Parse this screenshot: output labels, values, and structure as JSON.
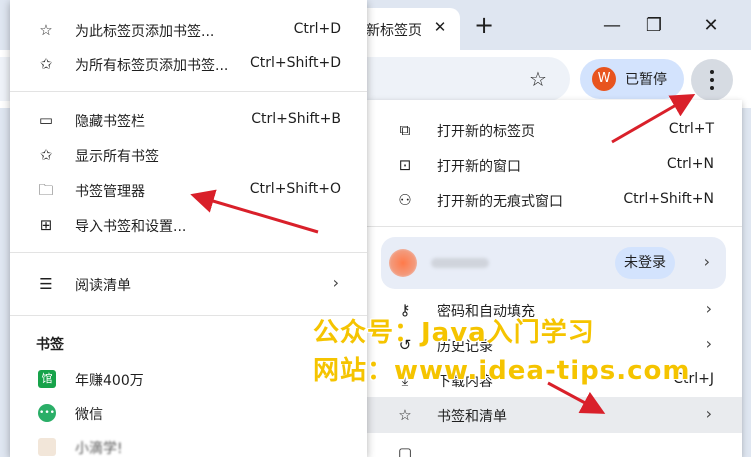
{
  "browser": {
    "tab_title": "新标签页",
    "profile_chip": {
      "initial": "W",
      "label": "已暂停"
    }
  },
  "main_menu": {
    "items_top": [
      {
        "icon": "new-tab-icon",
        "label": "打开新的标签页",
        "shortcut": "Ctrl+T"
      },
      {
        "icon": "new-window-icon",
        "label": "打开新的窗口",
        "shortcut": "Ctrl+N"
      },
      {
        "icon": "incognito-icon",
        "label": "打开新的无痕式窗口",
        "shortcut": "Ctrl+Shift+N"
      }
    ],
    "profile": {
      "login_label": "未登录"
    },
    "items_bottom": [
      {
        "icon": "key-icon",
        "label": "密码和自动填充"
      },
      {
        "icon": "history-icon",
        "label": "历史记录"
      },
      {
        "icon": "download-icon",
        "label": "下载内容",
        "shortcut": "Ctrl+J"
      },
      {
        "icon": "star-icon",
        "label": "书签和清单"
      }
    ]
  },
  "bookmarks_menu": {
    "items_top": [
      {
        "icon": "star-outline-icon",
        "label": "为此标签页添加书签...",
        "shortcut": "Ctrl+D"
      },
      {
        "icon": "star-multi-icon",
        "label": "为所有标签页添加书签...",
        "shortcut": "Ctrl+Shift+D"
      }
    ],
    "items_mid": [
      {
        "icon": "bookmark-bar-icon",
        "label": "隐藏书签栏",
        "shortcut": "Ctrl+Shift+B"
      },
      {
        "icon": "star-multi-icon",
        "label": "显示所有书签"
      },
      {
        "icon": "folder-icon",
        "label": "书签管理器",
        "shortcut": "Ctrl+Shift+O"
      },
      {
        "icon": "book-icon",
        "label": "导入书签和设置..."
      }
    ],
    "reading_list": {
      "icon": "list-icon",
      "label": "阅读清单"
    },
    "bookmarks_heading": "书签",
    "bookmarks": [
      {
        "icon": "site-favicon-icon",
        "favicon_text": "馆",
        "label": "年赚400万"
      },
      {
        "icon": "wechat-icon",
        "favicon_text": "•••",
        "label": "微信"
      },
      {
        "icon": "blurred-favicon-icon",
        "label": "小滴学!"
      }
    ]
  },
  "watermark": {
    "line1": "公众号：Java入门学习",
    "line2": "网站：www.idea-tips.com"
  },
  "colors": {
    "accent_arrow": "#d9202a",
    "watermark": "#f5c400",
    "chip_blue": "#d3e3fd"
  }
}
